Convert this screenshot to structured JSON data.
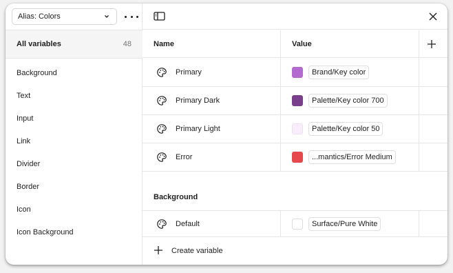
{
  "sidebar": {
    "collection_label": "Alias: Colors",
    "all_variables": {
      "label": "All variables",
      "count": "48"
    },
    "groups": [
      {
        "label": "Background"
      },
      {
        "label": "Text"
      },
      {
        "label": "Input"
      },
      {
        "label": "Link"
      },
      {
        "label": "Divider"
      },
      {
        "label": "Border"
      },
      {
        "label": "Icon"
      },
      {
        "label": "Icon Background"
      }
    ]
  },
  "table": {
    "headers": {
      "name": "Name",
      "value": "Value"
    },
    "rows": [
      {
        "name": "Primary",
        "value": "Brand/Key color",
        "swatch": "#b36bd0",
        "icon": "palette-icon"
      },
      {
        "name": "Primary Dark",
        "value": "Palette/Key color 700",
        "swatch": "#7a3f8a",
        "icon": "palette-icon"
      },
      {
        "name": "Primary Light",
        "value": "Palette/Key color 50",
        "swatch": "#f9edfb",
        "icon": "palette-icon"
      },
      {
        "name": "Error",
        "value": "...mantics/Error Medium",
        "swatch": "#e5484d",
        "icon": "palette-icon"
      }
    ],
    "section": {
      "title": "Background",
      "rows": [
        {
          "name": "Default",
          "value": "Surface/Pure White",
          "swatch": "#ffffff",
          "icon": "palette-icon"
        }
      ]
    }
  },
  "footer": {
    "create_label": "Create variable"
  },
  "colors": {
    "divider": "#e6e6e6",
    "selected_bg": "#f5f5f5",
    "text": "#1e1e1e",
    "muted": "#757575"
  }
}
